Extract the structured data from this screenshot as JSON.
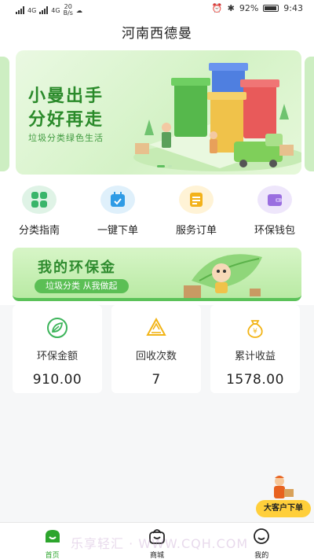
{
  "status_bar": {
    "network_left": "4G",
    "network_right": "4G",
    "speed_value": "20",
    "speed_unit": "B/s",
    "battery_pct": "92%",
    "time": "9:43"
  },
  "header": {
    "title": "河南西德曼"
  },
  "banner": {
    "title_line1": "小曼出手",
    "title_line2": "分好再走",
    "subtitle": "垃圾分类绿色生活",
    "pages": 2,
    "active_page": 1
  },
  "menu": [
    {
      "label": "分类指南",
      "icon": "grid-icon",
      "bg": "#dff3e6",
      "fg": "#39b56a"
    },
    {
      "label": "一键下单",
      "icon": "calendar-icon",
      "bg": "#dff0fb",
      "fg": "#2f9be5"
    },
    {
      "label": "服务订单",
      "icon": "order-icon",
      "bg": "#fff3d6",
      "fg": "#f3b21a"
    },
    {
      "label": "环保钱包",
      "icon": "wallet-icon",
      "bg": "#eee6fb",
      "fg": "#9a6ee0"
    }
  ],
  "promo": {
    "title": "我的环保金",
    "pill": "垃圾分类 从我做起"
  },
  "stats": [
    {
      "label": "环保金额",
      "value": "910.00",
      "icon": "leaf-icon",
      "color": "#3cb45a"
    },
    {
      "label": "回收次数",
      "value": "7",
      "icon": "recycle-icon",
      "color": "#f2b416"
    },
    {
      "label": "累计收益",
      "value": "1578.00",
      "icon": "money-bag-icon",
      "color": "#f2b416"
    }
  ],
  "float_button": {
    "label": "大客户下单"
  },
  "tabbar": [
    {
      "label": "首页",
      "icon": "home-icon",
      "active": true
    },
    {
      "label": "商城",
      "icon": "mall-icon",
      "active": false
    },
    {
      "label": "我的",
      "icon": "profile-icon",
      "active": false
    }
  ],
  "colors": {
    "accent": "#2da52d",
    "brand_green": "#5bbf55"
  },
  "watermark": "乐享轻汇 · WWW.CQH.COM"
}
